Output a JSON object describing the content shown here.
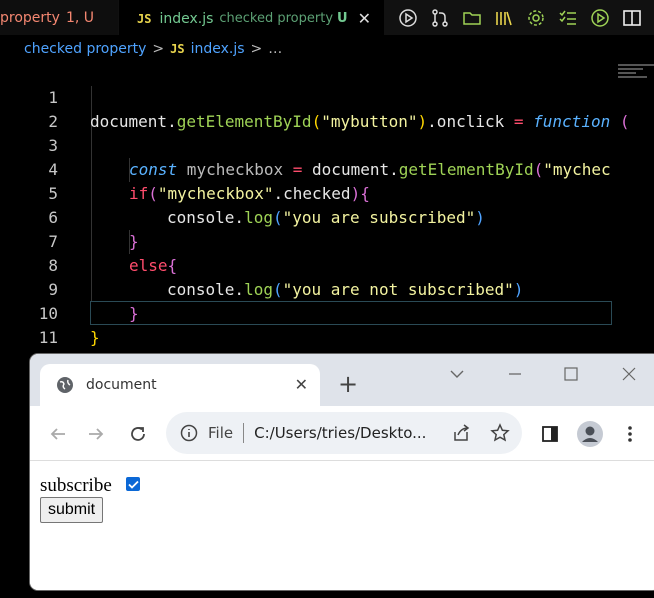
{
  "editor_tabs": [
    {
      "label": "property",
      "status": "1, U"
    },
    {
      "badge": "JS",
      "label": "index.js",
      "description": "checked property",
      "status": "U",
      "close": "✕"
    }
  ],
  "breadcrumb": {
    "folder": "checked property",
    "sep": ">",
    "badge": "JS",
    "file": "index.js",
    "more": "…"
  },
  "toolbar_icons": [
    "run-icon",
    "source-control-icon",
    "open-folder-icon",
    "library-icon",
    "settings-gear-icon",
    "list-check-icon",
    "run-circle-icon",
    "split-editor-icon"
  ],
  "code": {
    "line_numbers": [
      "1",
      "2",
      "3",
      "4",
      "5",
      "6",
      "7",
      "8",
      "9",
      "10",
      "11"
    ],
    "line1": {
      "a": "document",
      "b": ".",
      "c": "getElementById",
      "d": "(",
      "e": "\"mybutton\"",
      "f": ")",
      "g": ".onclick ",
      "h": "=",
      "i": " function",
      "j": " ("
    },
    "line3": {
      "a": "const",
      "b": " mycheckbox ",
      "c": "=",
      "d": " document.",
      "e": "getElementById",
      "f": "(",
      "g": "\"mychec"
    },
    "line4": {
      "a": "if",
      "b": "(",
      "c": "\"mycheckbox\"",
      "d": ".checked",
      "e": ")",
      "f": "{"
    },
    "line5": {
      "a": "console.",
      "b": "log",
      "c": "(",
      "d": "\"you are subscribed\"",
      "e": ")"
    },
    "line6": {
      "a": "}"
    },
    "line7": {
      "a": "else",
      "b": "{"
    },
    "line8": {
      "a": "console.",
      "b": "log",
      "c": "(",
      "d": "\"you are not subscribed\"",
      "e": ")"
    },
    "line9": {
      "a": "}"
    },
    "line10": {
      "a": "}"
    }
  },
  "browser": {
    "tab_title": "document",
    "tab_close": "✕",
    "new_tab": "+",
    "omnibox_scheme": "File",
    "omnibox_url": "C:/Users/tries/Deskto...",
    "page": {
      "checkbox_label": "subscribe",
      "checkbox_checked": true,
      "submit_label": "submit"
    }
  },
  "colors": {
    "accent": "#0b68d6",
    "modified": "#73c991",
    "error": "#f48771"
  }
}
